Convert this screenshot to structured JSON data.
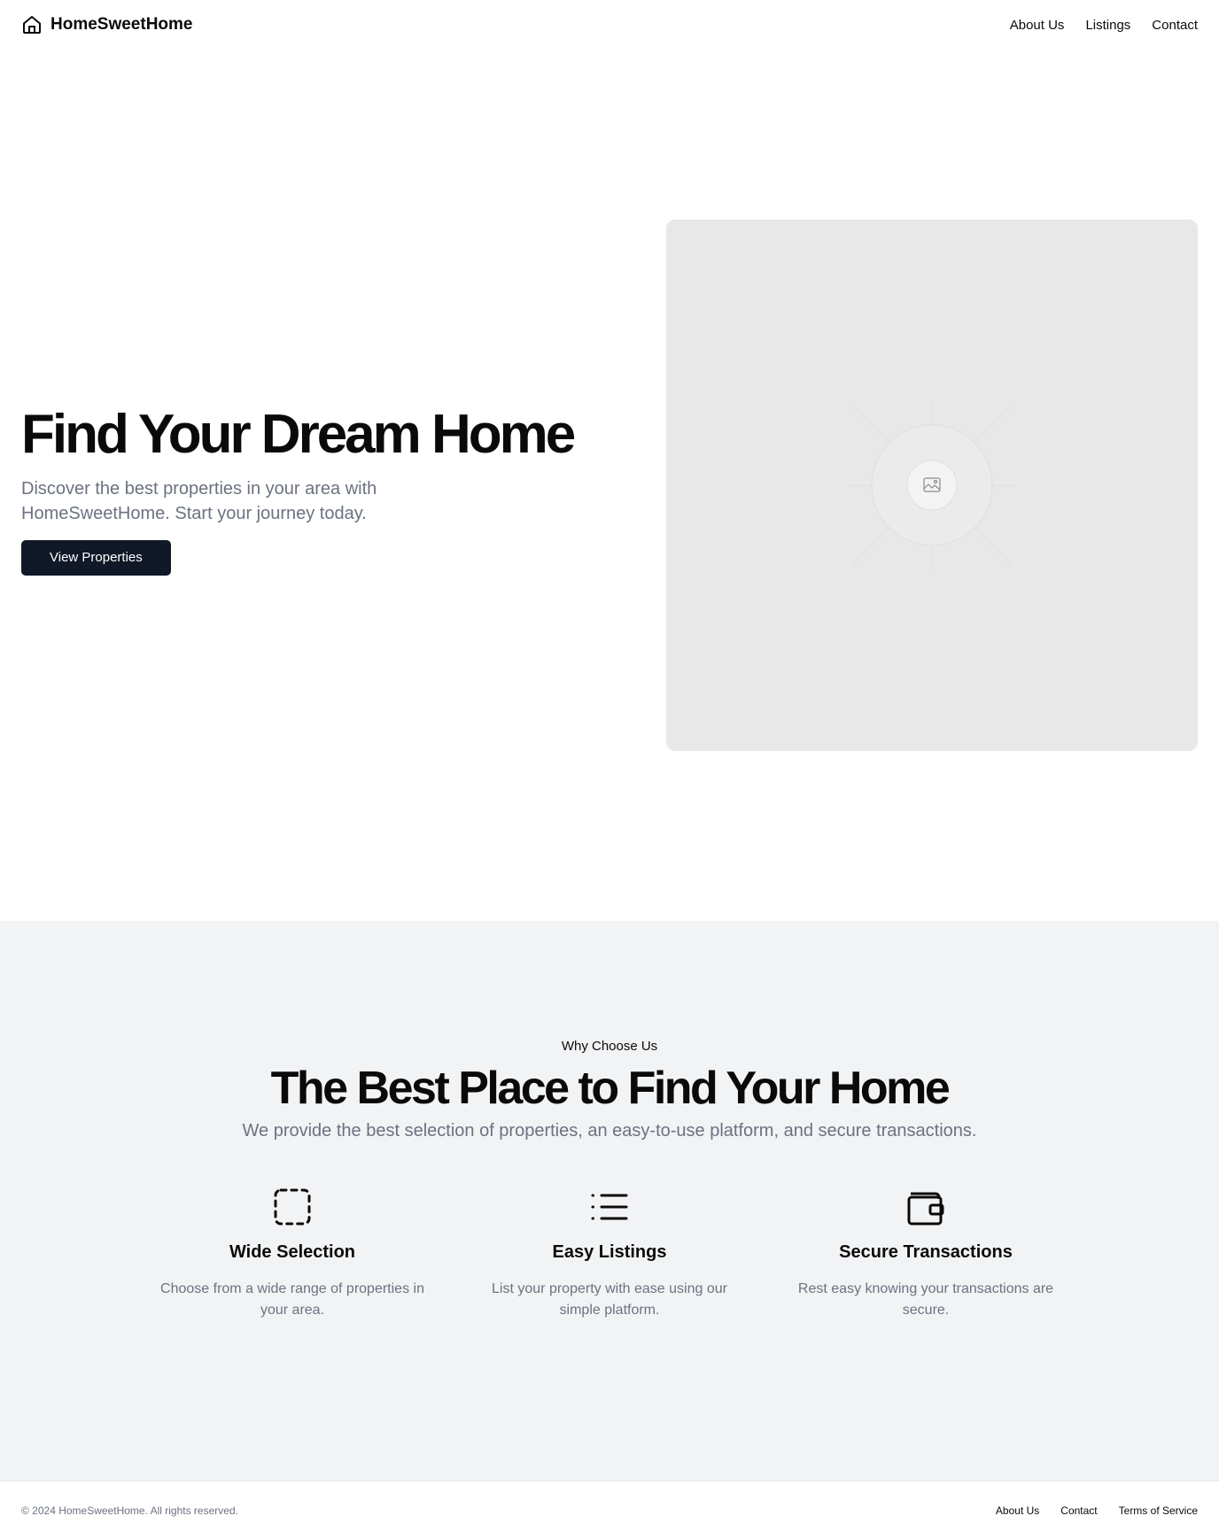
{
  "header": {
    "brand": "HomeSweetHome",
    "brand_icon": "home-icon",
    "nav": [
      "About Us",
      "Listings",
      "Contact"
    ]
  },
  "hero": {
    "title": "Find Your Dream Home",
    "subtitle": "Discover the best properties in your area with HomeSweetHome. Start your journey today.",
    "cta": "View Properties",
    "image_icon": "image-placeholder-icon"
  },
  "features": {
    "eyebrow": "Why Choose Us",
    "title": "The Best Place to Find Your Home",
    "subtitle": "We provide the best selection of properties, an easy-to-use platform, and secure transactions.",
    "items": [
      {
        "icon": "selection-icon",
        "title": "Wide Selection",
        "text": "Choose from a wide range of properties in your area."
      },
      {
        "icon": "list-icon",
        "title": "Easy Listings",
        "text": "List your property with ease using our simple platform."
      },
      {
        "icon": "wallet-icon",
        "title": "Secure Transactions",
        "text": "Rest easy knowing your transactions are secure."
      }
    ]
  },
  "footer": {
    "copyright": "© 2024 HomeSweetHome. All rights reserved.",
    "links": [
      "About Us",
      "Contact",
      "Terms of Service"
    ]
  },
  "colors": {
    "primary_button": "#111827",
    "muted_text": "#6b7280",
    "section_bg": "#f2f3f5",
    "image_bg": "#e8e8e8"
  }
}
